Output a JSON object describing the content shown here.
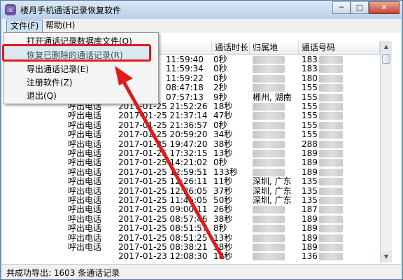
{
  "window": {
    "title": "楼月手机通话记录恢复软件",
    "icon_glyph": "☏",
    "min": "─",
    "max": "□",
    "close": "✕"
  },
  "menubar": {
    "file": "文件(F)",
    "help": "帮助(H)"
  },
  "file_menu": {
    "items": [
      "打开通话记录数据库文件(O)",
      "恢复已删除的通话记录(R)",
      "导出通话记录(E)",
      "注册软件(Z)",
      "退出(Q)"
    ]
  },
  "columns": {
    "type": "",
    "time": "",
    "duration": "通话时长",
    "location": "归属地",
    "number": "通话号码"
  },
  "rows": [
    {
      "type": "",
      "time": "11:59:40",
      "duration": "0秒",
      "location": "",
      "number": "183"
    },
    {
      "type": "",
      "time": "11:59:34",
      "duration": "0秒",
      "location": "",
      "number": "183"
    },
    {
      "type": "",
      "time": "11:59:22",
      "duration": "0秒",
      "location": "",
      "number": "180"
    },
    {
      "type": "",
      "time": "08:47:18",
      "duration": "2秒",
      "location": "",
      "number": "155"
    },
    {
      "type": "",
      "time": "07:57:13",
      "duration": "9秒",
      "location": "郴州, 湖南",
      "number": "155"
    },
    {
      "type": "呼出电话",
      "time": "2017-01-25 21:52:26",
      "duration": "18秒",
      "location": "",
      "number": "155"
    },
    {
      "type": "呼出电话",
      "time": "2017-01-25 21:37:14",
      "duration": "47秒",
      "location": "",
      "number": "155"
    },
    {
      "type": "呼出电话",
      "time": "2017-01-25 21:36:57",
      "duration": "0秒",
      "location": "",
      "number": "155"
    },
    {
      "type": "呼出电话",
      "time": "2017-01-25 20:59:20",
      "duration": "34秒",
      "location": "",
      "number": "155"
    },
    {
      "type": "呼出电话",
      "time": "2017-01-25 19:47:20",
      "duration": "38秒",
      "location": "",
      "number": "288"
    },
    {
      "type": "呼出电话",
      "time": "2017-01-25 17:32:15",
      "duration": "13秒",
      "location": "",
      "number": "189"
    },
    {
      "type": "呼出电话",
      "time": "2017-01-25 14:21:02",
      "duration": "0秒",
      "location": "",
      "number": "189"
    },
    {
      "type": "呼出电话",
      "time": "2017-01-25 12:59:51",
      "duration": "133秒",
      "location": "",
      "number": "189"
    },
    {
      "type": "呼出电话",
      "time": "2017-01-25 12:26:11",
      "duration": "11秒",
      "location": "深圳, 广东",
      "number": "135"
    },
    {
      "type": "呼出电话",
      "time": "2017-01-25 12:26:05",
      "duration": "37秒",
      "location": "深圳, 广东",
      "number": "135"
    },
    {
      "type": "呼出电话",
      "time": "2017-01-25 11:45:05",
      "duration": "50秒",
      "location": "深圳, 广东",
      "number": "135"
    },
    {
      "type": "呼出电话",
      "time": "2017-01-25 09:00:11",
      "duration": "26秒",
      "location": "",
      "number": "187"
    },
    {
      "type": "呼出电话",
      "time": "2017-01-25 08:57:46",
      "duration": "38秒",
      "location": "",
      "number": "189"
    },
    {
      "type": "呼出电话",
      "time": "2017-01-25 08:51:57",
      "duration": "8秒",
      "location": "",
      "number": "189"
    },
    {
      "type": "呼出电话",
      "time": "2017-01-25 08:51:25",
      "duration": "13秒",
      "location": "",
      "number": "189"
    },
    {
      "type": "呼出电话",
      "time": "2017-01-25 08:38:21",
      "duration": "38秒",
      "location": "",
      "number": "189"
    },
    {
      "type": "",
      "time": "2017-01-23 12:08:30",
      "duration": "18秒",
      "location": "",
      "number": "136"
    }
  ],
  "status": {
    "text": "共成功导出: 1603 条通话记录"
  },
  "colors": {
    "highlight": "#e21a1a",
    "arrow": "#e21a1a",
    "title_bg": "#c9d9ec"
  }
}
